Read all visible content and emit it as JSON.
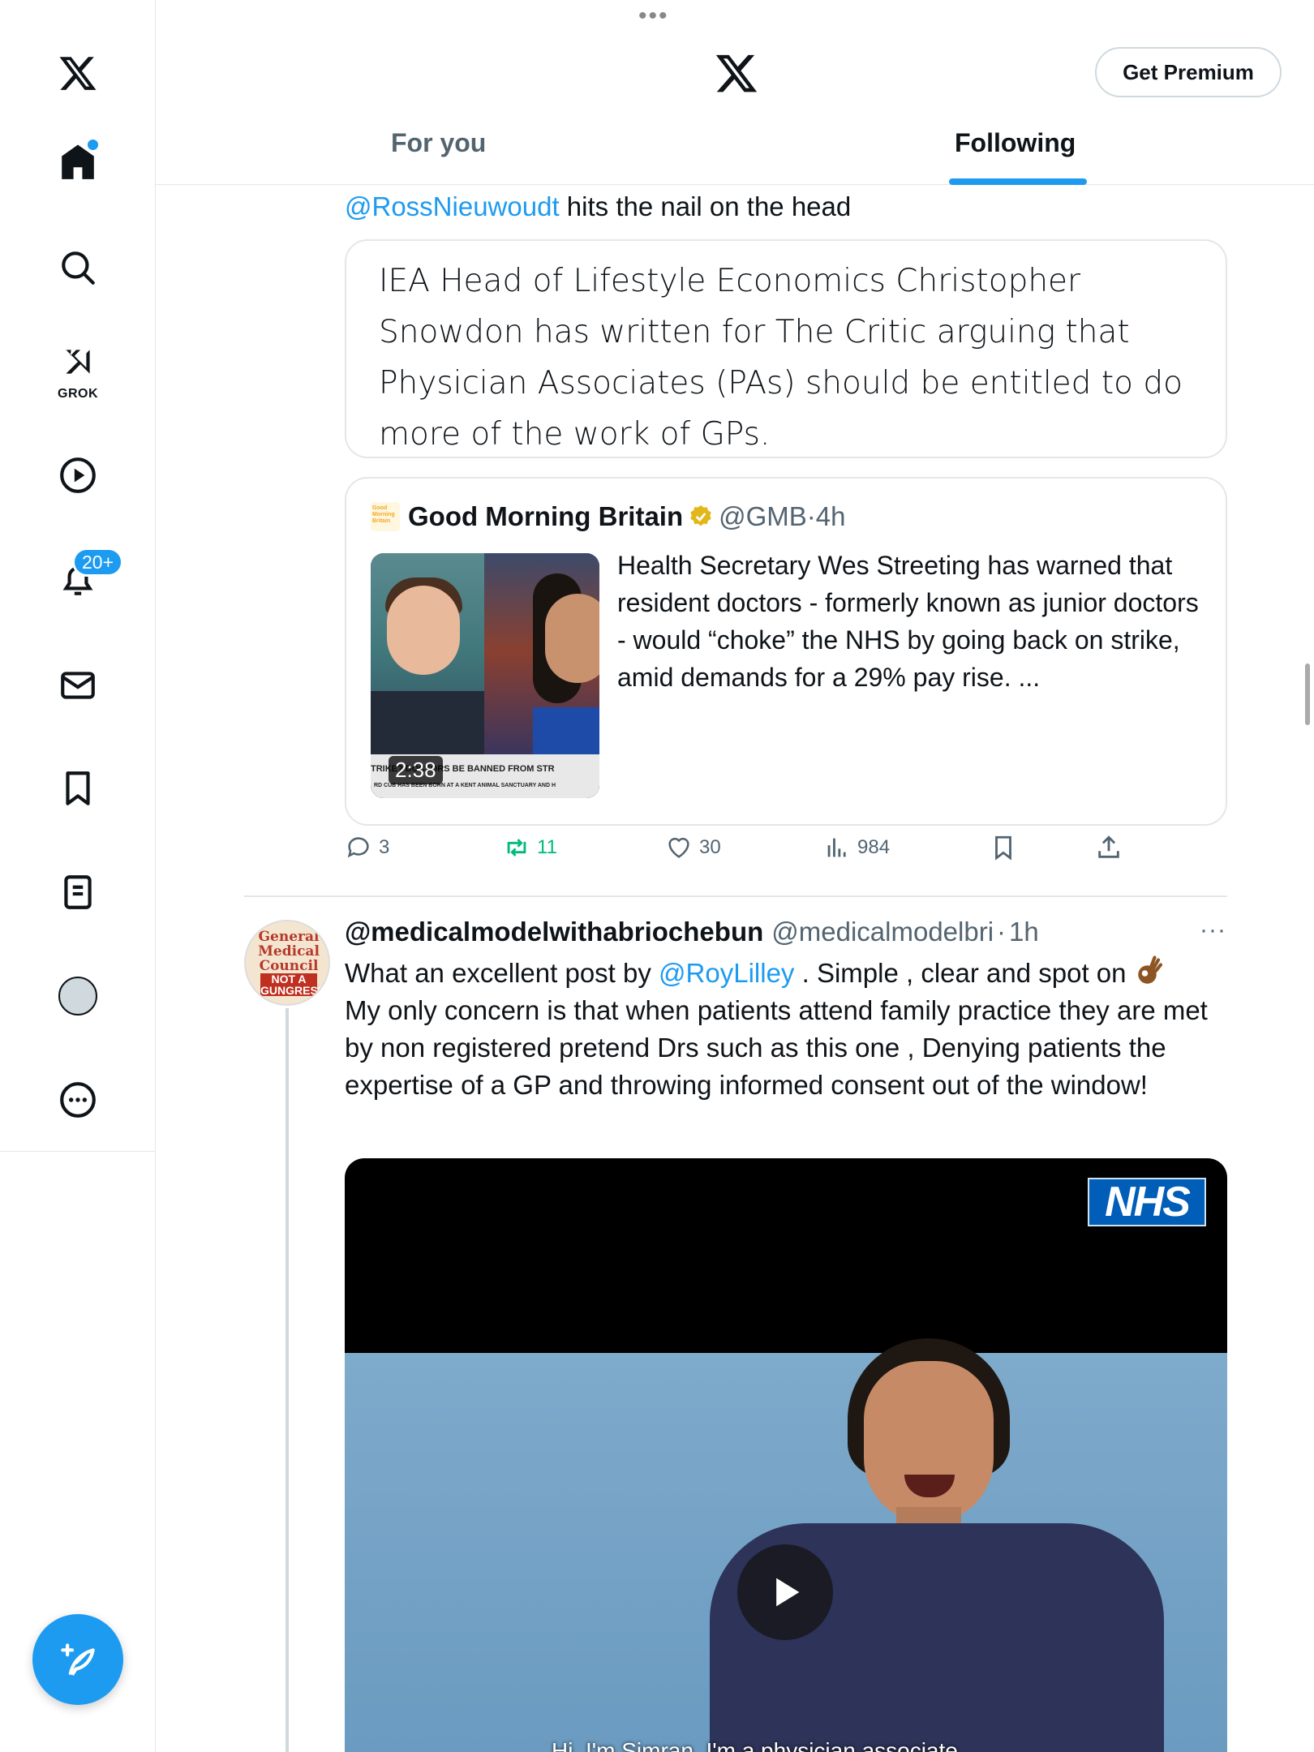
{
  "header": {
    "premium_label": "Get Premium",
    "tabs": [
      {
        "label": "For you",
        "selected": false
      },
      {
        "label": "Following",
        "selected": true
      }
    ]
  },
  "sidebar": {
    "items": [
      {
        "name": "x-logo"
      },
      {
        "name": "home",
        "has_dot": true
      },
      {
        "name": "search"
      },
      {
        "name": "grok",
        "label": "GROK"
      },
      {
        "name": "videos"
      },
      {
        "name": "notifications",
        "badge": "20+"
      },
      {
        "name": "messages"
      },
      {
        "name": "bookmarks"
      },
      {
        "name": "lists"
      },
      {
        "name": "profile"
      },
      {
        "name": "more"
      }
    ]
  },
  "post1": {
    "mention": "@RossNieuwoudt",
    "text_after": " hits the nail on the head",
    "quoted_text": "IEA Head of Lifestyle Economics Christopher Snowdon has written for The Critic arguing that Physician Associates (PAs) should be entitled to do more of the work of GPs.",
    "quote": {
      "logo_text": "Good Morning Britain",
      "name": "Good Morning Britain",
      "handle": "@GMB",
      "time": "4h",
      "body": "Health Secretary Wes Streeting has warned that resident doctors - formerly known as junior doctors - would “choke” the NHS by going back on strike, amid demands for a 29% pay rise. ...",
      "video_duration": "2:38",
      "ticker_text": "TRIKE? DOCTORS BE BANNED FROM STR",
      "ticker_sub": "RD CUB HAS BEEN BORN AT A KENT ANIMAL SANCTUARY AND H"
    },
    "actions": {
      "replies": "3",
      "reposts": "11",
      "likes": "30",
      "views": "984"
    }
  },
  "post2": {
    "name": "@medicalmodelwithabriochebun",
    "handle": "@medicalmodelbri",
    "time": "1h",
    "more": "···",
    "avatar_text": "General Medical Council",
    "avatar_sub": "NOT A GUNGRESS",
    "body_before": "What an excellent post by ",
    "mention": "@RoyLilley",
    "body_after_mention": " . Simple , clear and spot on ",
    "body_rest": "My only concern is that when patients attend family practice they are met by non registered pretend Drs such as this one , Denying patients the expertise of a GP and throwing informed consent out of the window!",
    "video": {
      "logo": "NHS",
      "subtitle": "Hi, I'm Simran. I'm a physician associate"
    }
  },
  "colors": {
    "accent": "#1d9bf0",
    "repost": "#00ba7c",
    "secondary_text": "#536471",
    "border": "#e6e6e6"
  }
}
